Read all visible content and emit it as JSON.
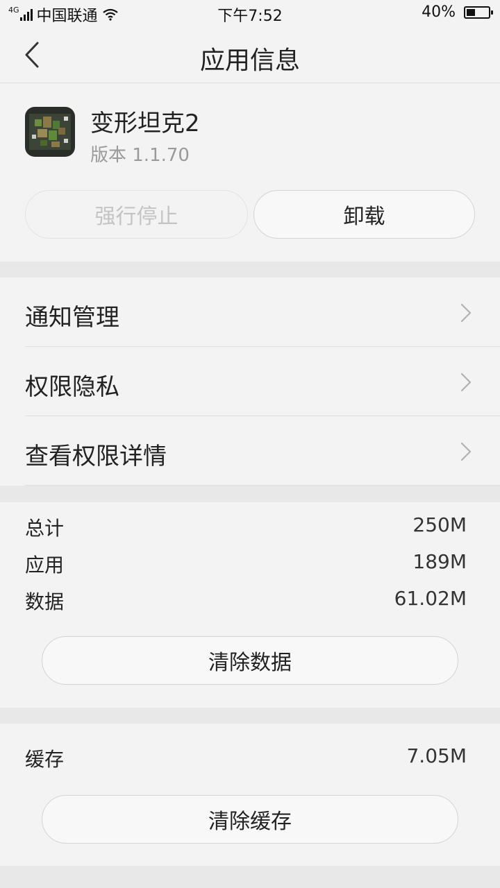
{
  "status_bar": {
    "network": "4G",
    "carrier": "中国联通",
    "time": "下午7:52",
    "battery_percent_text": "40%",
    "battery_level": 0.4
  },
  "title_bar": {
    "title": "应用信息"
  },
  "app": {
    "name": "变形坦克2",
    "version": "版本 1.1.70",
    "force_stop_label": "强行停止",
    "uninstall_label": "卸载"
  },
  "menu": {
    "items": [
      {
        "label": "通知管理"
      },
      {
        "label": "权限隐私"
      },
      {
        "label": "查看权限详情"
      }
    ]
  },
  "storage": {
    "total_label": "总计",
    "total_value": "250M",
    "app_label": "应用",
    "app_value": "189M",
    "data_label": "数据",
    "data_value": "61.02M",
    "clear_data_label": "清除数据"
  },
  "cache": {
    "label": "缓存",
    "value": "7.05M",
    "clear_cache_label": "清除缓存"
  }
}
